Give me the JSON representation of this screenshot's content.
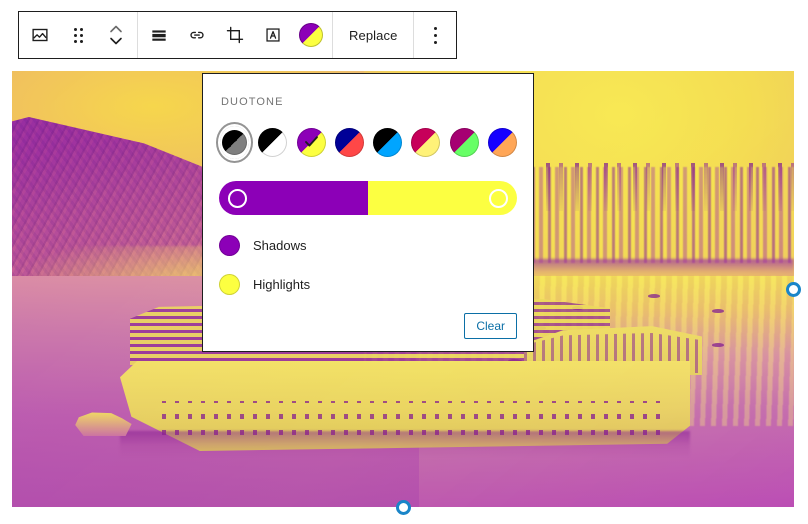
{
  "toolbar": {
    "groups": [
      {
        "name": "block-type-and-move",
        "items": [
          {
            "icon": "image-icon",
            "label": "Image"
          },
          {
            "icon": "drag-handle-icon",
            "label": "Drag"
          },
          {
            "icon": "move-up-down-icon",
            "label": "Move up or down"
          }
        ]
      },
      {
        "name": "block-formatting",
        "items": [
          {
            "icon": "align-icon",
            "label": "Align"
          },
          {
            "icon": "link-icon",
            "label": "Link"
          },
          {
            "icon": "crop-icon",
            "label": "Crop"
          },
          {
            "icon": "add-text-over-image-icon",
            "label": "Add text over image"
          },
          {
            "icon": "duotone-icon",
            "label": "Apply duotone filter"
          }
        ]
      },
      {
        "name": "replace-group",
        "items": [
          {
            "icon": "",
            "label": "Replace"
          }
        ]
      },
      {
        "name": "options-group",
        "items": [
          {
            "icon": "more-options-icon",
            "label": "Options"
          }
        ]
      }
    ],
    "replace_label": "Replace"
  },
  "duotone_panel": {
    "title": "DUOTONE",
    "presets": [
      {
        "name": "dark-grayscale",
        "shadow": "#000000",
        "highlight": "#7f7f7f",
        "selected": true,
        "checked": false
      },
      {
        "name": "grayscale",
        "shadow": "#000000",
        "highlight": "#ffffff",
        "selected": false,
        "checked": false
      },
      {
        "name": "purple-yellow",
        "shadow": "#8c00b7",
        "highlight": "#fcff41",
        "selected": false,
        "checked": true
      },
      {
        "name": "blue-red",
        "shadow": "#000097",
        "highlight": "#ff4747",
        "selected": false,
        "checked": false
      },
      {
        "name": "midnight",
        "shadow": "#000000",
        "highlight": "#00a5ff",
        "selected": false,
        "checked": false
      },
      {
        "name": "magenta-yellow",
        "shadow": "#c7005a",
        "highlight": "#fff278",
        "selected": false,
        "checked": false
      },
      {
        "name": "purple-green",
        "shadow": "#a60072",
        "highlight": "#67ff66",
        "selected": false,
        "checked": false
      },
      {
        "name": "blue-orange",
        "shadow": "#1500ff",
        "highlight": "#ffa657",
        "selected": false,
        "checked": false
      }
    ],
    "slider": {
      "shadow_color": "#8c00b7",
      "highlight_color": "#fcff41",
      "split_percent": 50
    },
    "colors": [
      {
        "name": "shadows",
        "label": "Shadows",
        "value": "#8c00b7"
      },
      {
        "name": "highlights",
        "label": "Highlights",
        "value": "#fcff41"
      }
    ],
    "clear_label": "Clear",
    "clear_color": "#0b6fa6"
  },
  "image_block": {
    "alt": "Duotone-filtered photo of a cruise ship in a coastal harbour with hills and a seaside town",
    "duotone_shadow": "#8c00b7",
    "duotone_highlight": "#fcff41",
    "handle_color": "#1a85c8",
    "handles": [
      {
        "name": "resize-handle-right",
        "position": "right-middle"
      },
      {
        "name": "resize-handle-bottom",
        "position": "bottom-center"
      }
    ]
  }
}
